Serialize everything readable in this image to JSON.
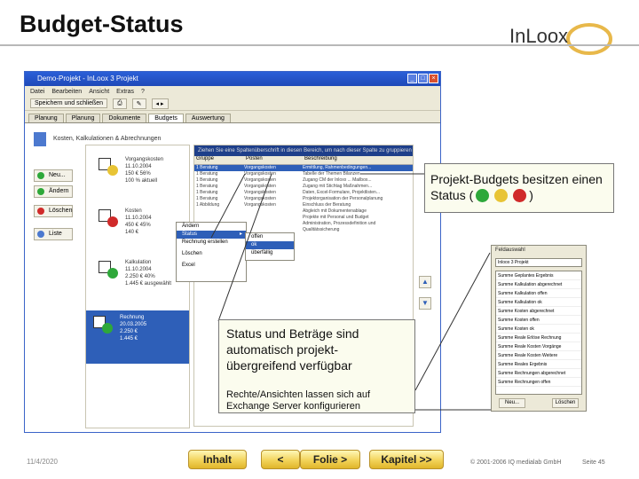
{
  "slide": {
    "title": "Budget-Status",
    "logo_text": "InLoox",
    "date": "11/4/2020",
    "copyright": "© 2001-2006 IQ medialab GmbH",
    "page": "Seite 45"
  },
  "window": {
    "title": "Demo-Projekt - InLoox 3 Projekt",
    "menu": [
      "Datei",
      "Bearbeiten",
      "Ansicht",
      "Extras",
      "?"
    ],
    "toolbar_save": "Speichern und schließen",
    "tabs": [
      "Planung",
      "Planung",
      "Dokumente",
      "Budgets",
      "Auswertung"
    ],
    "active_tab": 3,
    "header": "Kosten, Kalkulationen & Abrechnungen",
    "side_buttons": [
      {
        "label": "Neu...",
        "color": "#2ea83a"
      },
      {
        "label": "Ändern",
        "color": "#2ea83a"
      },
      {
        "label": "Löschen",
        "color": "#d02a2a"
      },
      {
        "label": "Liste",
        "color": "#4c79cf"
      }
    ],
    "cards": [
      {
        "lines": [
          "Vorgangskosten",
          "11.10.2004",
          "150 € 56%",
          "100 % aktuell"
        ],
        "status": "q"
      },
      {
        "lines": [
          "Kosten",
          "11.10.2004",
          "450 € 45%",
          "140 €"
        ],
        "status": "no"
      },
      {
        "lines": [
          "Kalkulation",
          "11.10.2004",
          "2.250 € 40%",
          "1.445 € ausgewählt"
        ],
        "status": "ok"
      },
      {
        "lines": [
          "Rechnung",
          "20.03.2005",
          "2.250 €",
          "1.445 €"
        ],
        "status": "ok"
      }
    ],
    "grid_banner": "Ziehen Sie eine Spaltenüberschrift in diesen Bereich, um nach dieser Spalte zu gruppieren",
    "grid_headers": [
      "Gruppe",
      "Posten",
      "Beschreibung"
    ],
    "grid_rows": [
      [
        "1 Beratung",
        "Vorgangskosten",
        "Ermittlung, Rahmenbedingungen..."
      ],
      [
        "1 Beratung",
        "Vorgangskosten",
        "Tabelle der Themen Bilanzen"
      ],
      [
        "1 Beratung",
        "Vorgangskosten",
        "Zugang CM der Inloxx ... Mailbox..."
      ],
      [
        "1 Beratung",
        "Vorgangskosten",
        "Zugang mit Stichtag Maßnahmen..."
      ],
      [
        "1 Beratung",
        "Vorgangskosten",
        "Daten, Excel-Formulare, Projektlisten..."
      ],
      [
        "1 Beratung",
        "Vorgangskosten",
        "Projektorganisation der Personalplanung"
      ],
      [
        "1 Abbildung",
        "Vorgangskosten",
        "Einschluss der Beratung"
      ],
      [
        "",
        "",
        "Abgleich mit Dokumentenablage"
      ],
      [
        "",
        "",
        "Projekte mit Personal und Budget"
      ],
      [
        "",
        "",
        "Administration, Prozessdefinition und"
      ],
      [
        "",
        "",
        "Qualitätssicherung"
      ]
    ],
    "context_menu": [
      "Ändern",
      "Status",
      "Rechnung erstellen",
      "Löschen",
      "Excel"
    ],
    "context_hl": 1,
    "submenu": [
      "offen",
      "ok",
      "überfällig"
    ],
    "submenu_hl": 1
  },
  "callouts": {
    "status_text": "Projekt-Budgets besitzen einen Status (",
    "status_close": ")",
    "status_colors": [
      "#2ea83a",
      "#e8c435",
      "#d02a2a"
    ],
    "main": "Status und Beträge sind automatisch projekt-übergreifend verfügbar",
    "sub": "Rechte/Ansichten lassen sich auf Exchange Server konfigurieren"
  },
  "field_panel": {
    "title": "Feldauswahl",
    "selected": "Inloox 3 Projekt",
    "items": [
      "Summe Geplantes Ergebnis",
      "Summe Kalkulation abgerechnet",
      "Summe Kalkulation offen",
      "Summe Kalkulation ok",
      "Summe Kosten abgerechnet",
      "Summe Kosten offen",
      "Summe Kosten ok",
      "Summe Reale Erlöse Rechnung",
      "Summe Reale Kosten Vorgänge",
      "Summe Reale Kosten Weitere",
      "Summe Reales Ergebnis",
      "Summe Rechnungen abgerechnet",
      "Summe Rechnungen offen"
    ],
    "new_button": "Neu...",
    "delete_button": "Löschen"
  },
  "nav": {
    "inhalt": "Inhalt",
    "back": "<",
    "folie": "Folie >",
    "kapitel": "Kapitel >>"
  }
}
